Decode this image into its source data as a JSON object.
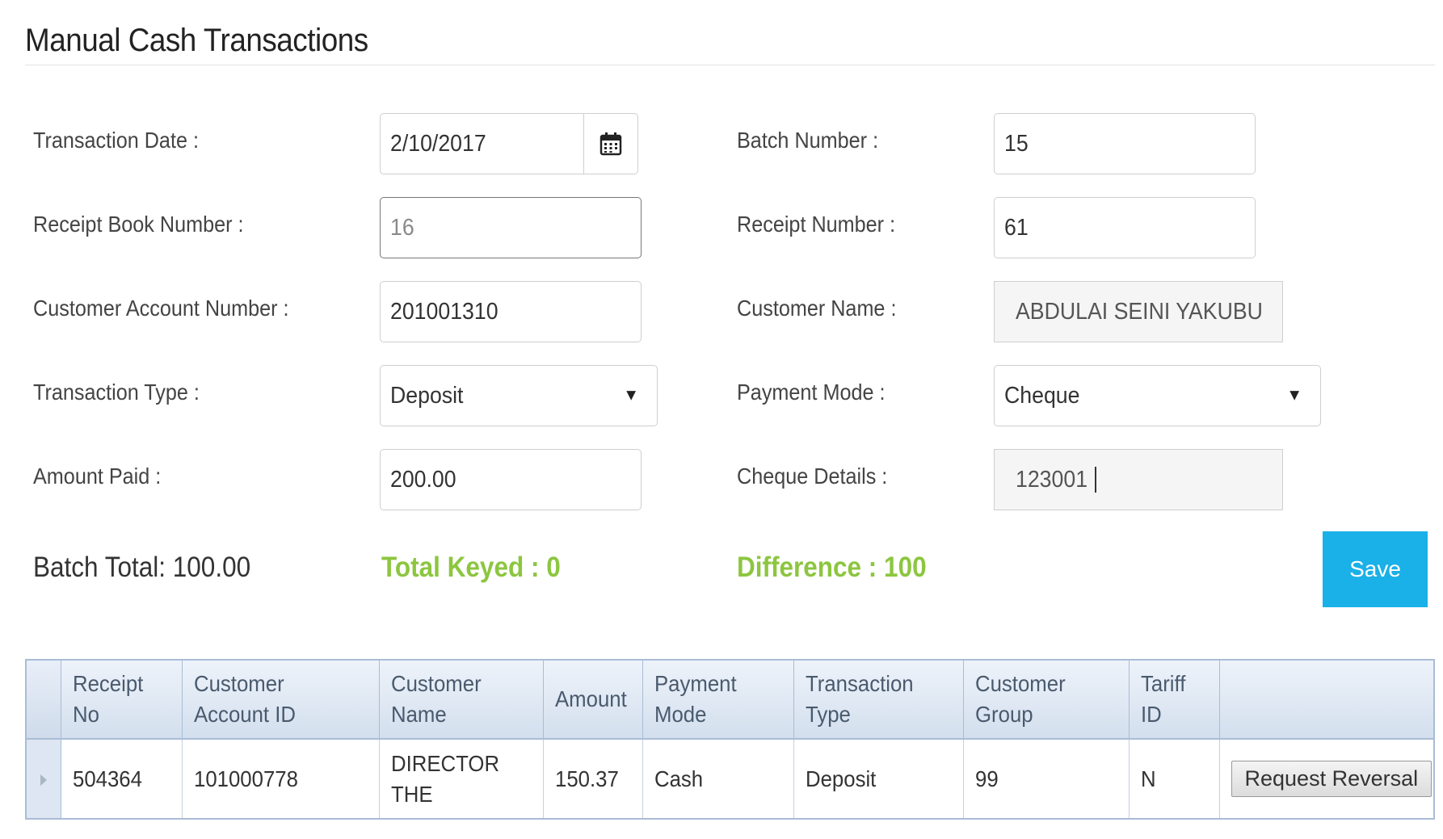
{
  "page": {
    "title": "Manual Cash Transactions"
  },
  "form": {
    "transaction_date": {
      "label": "Transaction Date :",
      "value": "2/10/2017",
      "icon": "calendar-icon"
    },
    "batch_number": {
      "label": "Batch Number :",
      "value": "15"
    },
    "receipt_book_number": {
      "label": "Receipt Book Number :",
      "placeholder": "16"
    },
    "receipt_number": {
      "label": "Receipt Number :",
      "value": "61"
    },
    "customer_account_number": {
      "label": "Customer Account Number :",
      "value": "201001310"
    },
    "customer_name": {
      "label": "Customer Name :",
      "value": "ABDULAI SEINI YAKUBU"
    },
    "transaction_type": {
      "label": "Transaction Type :",
      "value": "Deposit"
    },
    "payment_mode": {
      "label": "Payment Mode :",
      "value": "Cheque"
    },
    "amount_paid": {
      "label": "Amount Paid :",
      "value": "200.00"
    },
    "cheque_details": {
      "label": "Cheque Details :",
      "value": "123001"
    }
  },
  "summary": {
    "batch_total": "Batch Total: 100.00",
    "total_keyed": "Total Keyed : 0",
    "difference": "Difference : 100",
    "save_label": "Save"
  },
  "colors": {
    "accent_green": "#8cc63f",
    "save_blue": "#1ab0e8",
    "grid_border": "#a9bcd6"
  },
  "grid": {
    "headers": {
      "receipt_no": [
        "Receipt",
        "No"
      ],
      "customer_account_id": [
        "Customer",
        "Account ID"
      ],
      "customer_name": [
        "Customer",
        "Name"
      ],
      "amount": "Amount",
      "payment_mode": [
        "Payment",
        "Mode"
      ],
      "transaction_type": [
        "Transaction",
        "Type"
      ],
      "customer_group": [
        "Customer",
        "Group"
      ],
      "tariff_id": [
        "Tariff",
        "ID"
      ]
    },
    "rows": [
      {
        "receipt_no": "504364",
        "customer_account_id": "101000778",
        "customer_name": [
          "DIRECTOR",
          "THE"
        ],
        "amount": "150.37",
        "payment_mode": "Cash",
        "transaction_type": "Deposit",
        "customer_group": "99",
        "tariff_id": "N",
        "action_label": "Request Reversal"
      }
    ]
  }
}
